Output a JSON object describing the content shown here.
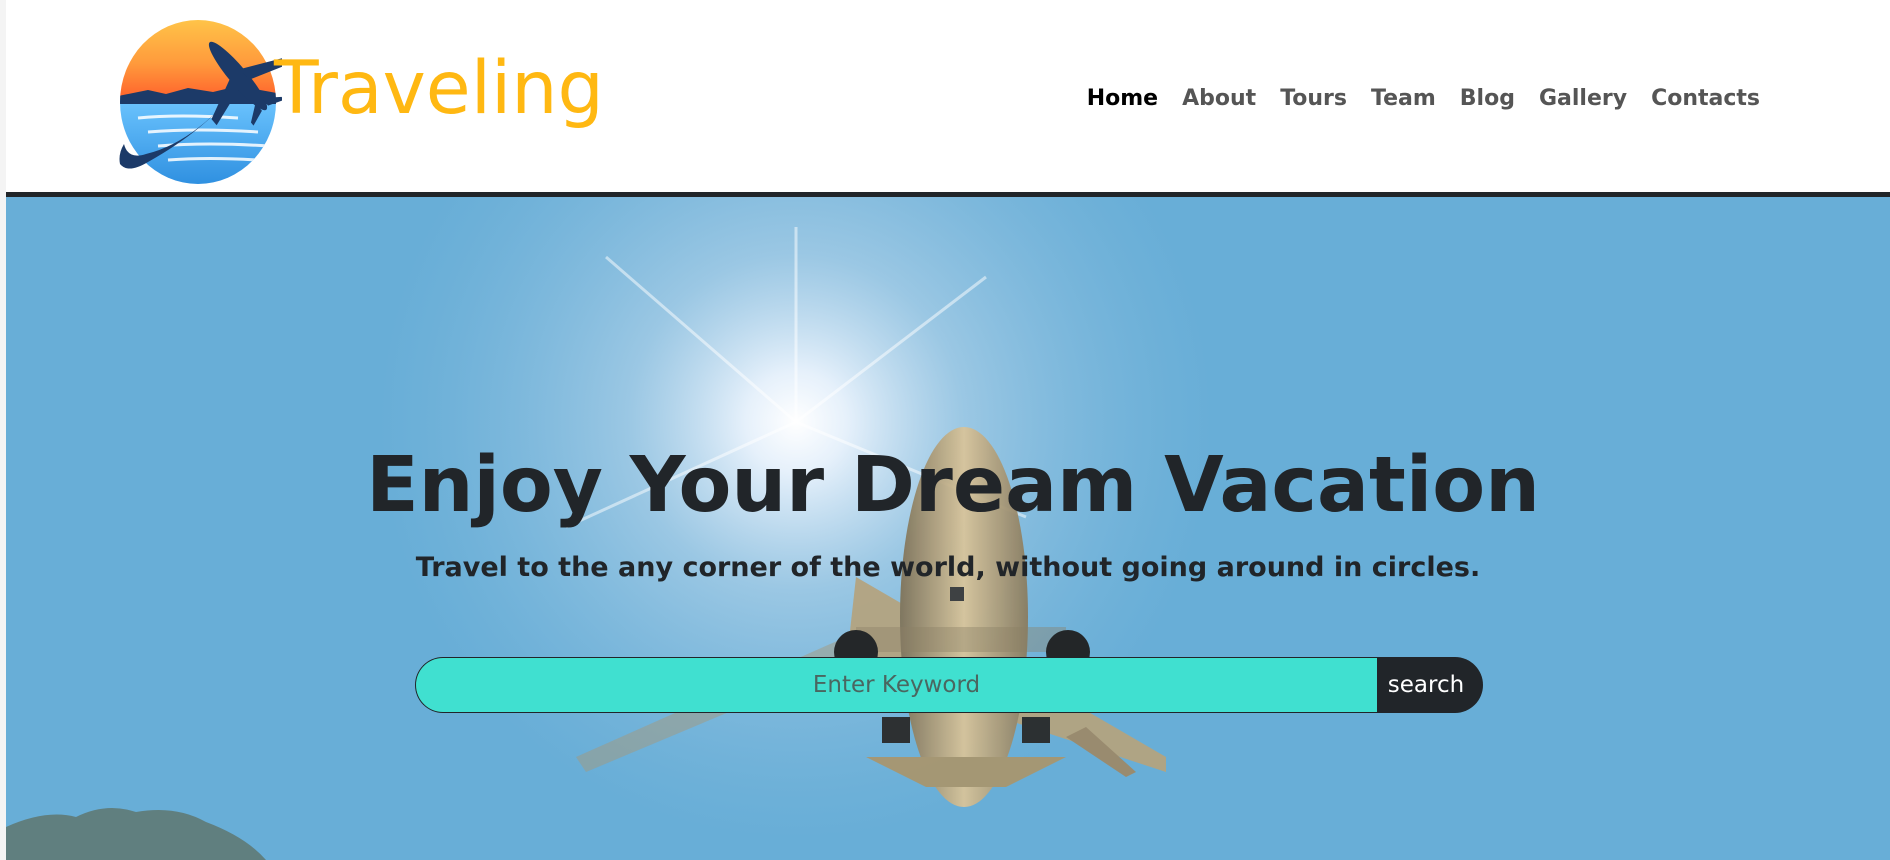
{
  "brand": {
    "name": "Traveling",
    "logo_icon": "airplane-sunset-logo",
    "color": "#ffb812"
  },
  "nav": {
    "items": [
      {
        "label": "Home",
        "active": true
      },
      {
        "label": "About",
        "active": false
      },
      {
        "label": "Tours",
        "active": false
      },
      {
        "label": "Team",
        "active": false
      },
      {
        "label": "Blog",
        "active": false
      },
      {
        "label": "Gallery",
        "active": false
      },
      {
        "label": "Contacts",
        "active": false
      }
    ]
  },
  "hero": {
    "background_image": "airplane-takeoff-sky-photo",
    "title": "Enjoy Your Dream Vacation",
    "subtitle": "Travel to the any corner of the world, without going around in circles.",
    "search": {
      "placeholder": "Enter Keyword",
      "value": "",
      "button_label": "search",
      "input_color": "#40e0d0",
      "button_color": "#212529"
    }
  }
}
